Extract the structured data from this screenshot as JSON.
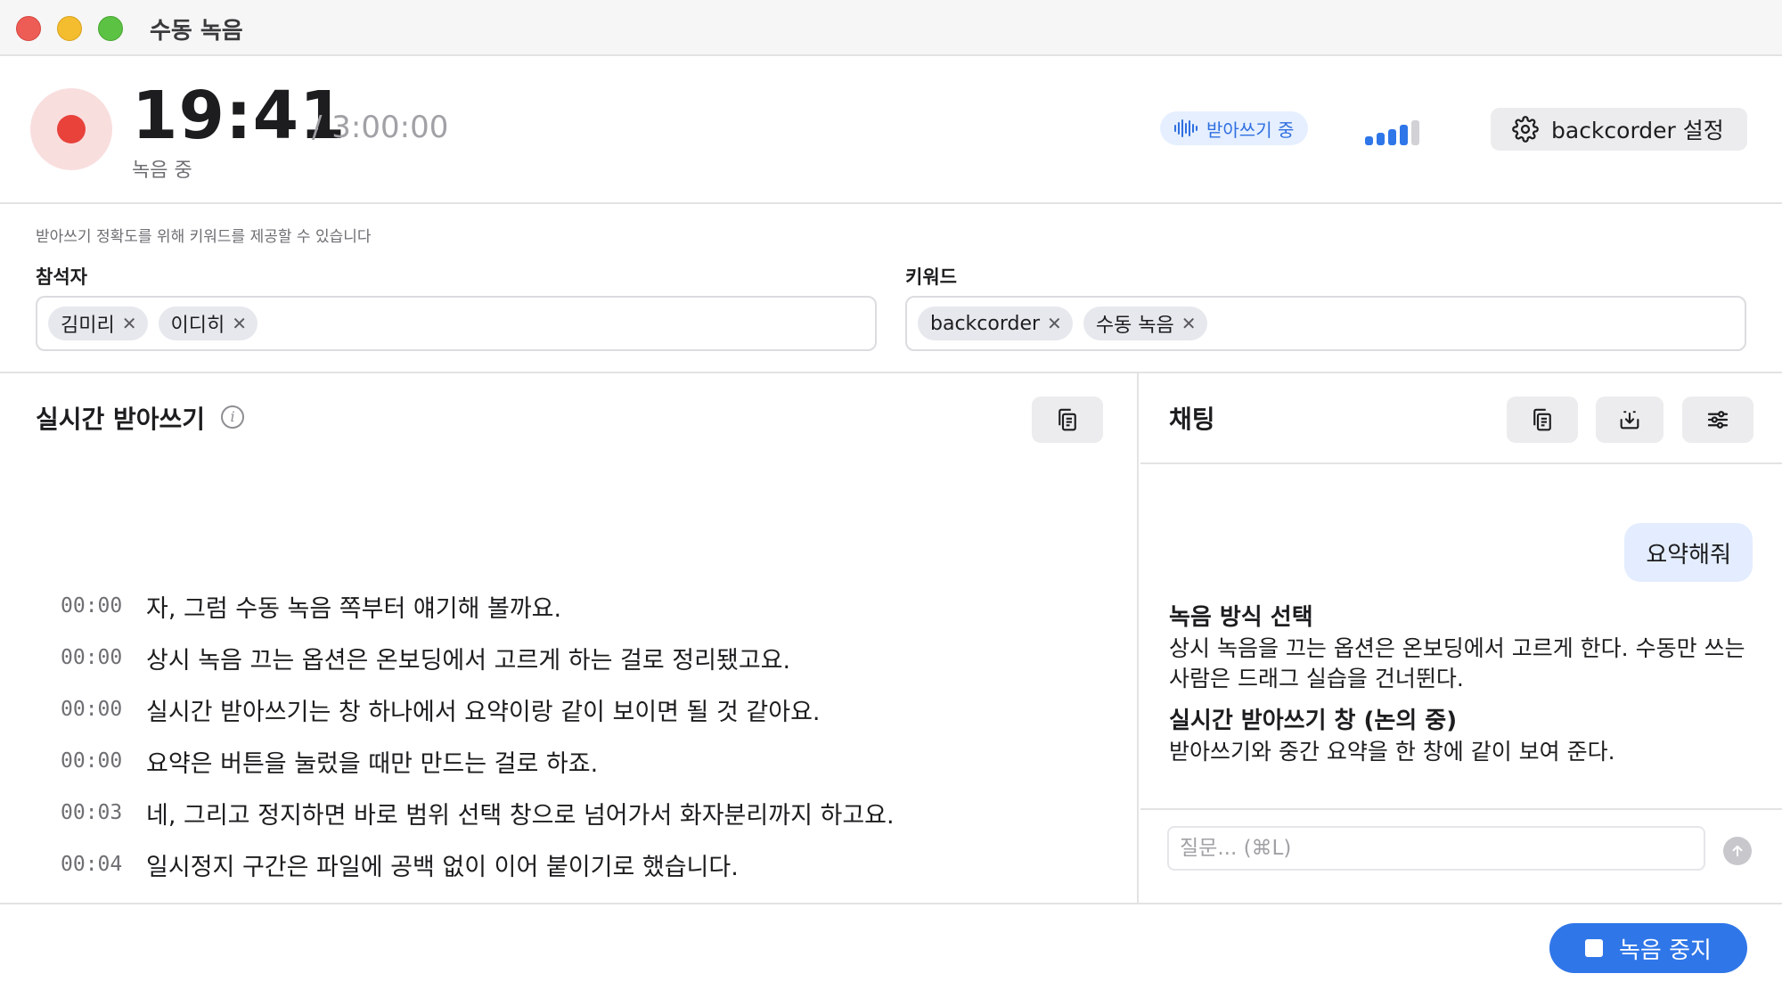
{
  "window": {
    "title": "수동 녹음"
  },
  "recording": {
    "elapsed": "19:41",
    "limit": "/ 3:00:00",
    "status": "녹음 중",
    "transcribing_label": "받아쓰기 중",
    "level_bars": 5,
    "level_active": 4
  },
  "settings_button": {
    "label": "backcorder 설정",
    "icon": "gear-icon"
  },
  "keywords_section": {
    "hint": "받아쓰기 정확도를 위해 키워드를 제공할 수 있습니다",
    "participants": {
      "label": "참석자",
      "chips": [
        "김미리",
        "이디히"
      ]
    },
    "keywords": {
      "label": "키워드",
      "chips": [
        "backcorder",
        "수동 녹음"
      ]
    }
  },
  "transcript": {
    "title": "실시간 받아쓰기",
    "lines": [
      {
        "time": "00:00",
        "text": "자, 그럼 수동 녹음 쪽부터 얘기해 볼까요."
      },
      {
        "time": "00:00",
        "text": "상시 녹음 끄는 옵션은 온보딩에서 고르게 하는 걸로 정리됐고요."
      },
      {
        "time": "00:00",
        "text": "실시간 받아쓰기는 창 하나에서 요약이랑 같이 보이면 될 것 같아요."
      },
      {
        "time": "00:00",
        "text": "요약은 버튼을 눌렀을 때만 만드는 걸로 하죠."
      },
      {
        "time": "00:03",
        "text": "네, 그리고 정지하면 바로 범위 선택 창으로 넘어가서 화자분리까지 하고요."
      },
      {
        "time": "00:04",
        "text": "일시정지 구간은 파일에 공백 없이 이어 붙이기로 했습니다."
      }
    ]
  },
  "chat": {
    "title": "채팅",
    "user_message": "요약해줘",
    "summary": [
      {
        "heading": "녹음 방식 선택",
        "body": "상시 녹음을 끄는 옵션은 온보딩에서 고르게 한다. 수동만 쓰는 사람은 드래그 실습을 건너뛴다."
      },
      {
        "heading": "실시간 받아쓰기 창 (논의 중)",
        "body": "받아쓰기와 중간 요약을 한 창에 같이 보여 준다."
      }
    ],
    "input_placeholder": "질문... (⌘L)",
    "input_value": ""
  },
  "footer": {
    "stop_label": "녹음 중지"
  },
  "colors": {
    "accent": "#2f76e8",
    "record_red": "#e8423b",
    "record_halo": "#f9dede",
    "badge_bg": "#e5efff",
    "badge_text": "#2f6fe0"
  }
}
